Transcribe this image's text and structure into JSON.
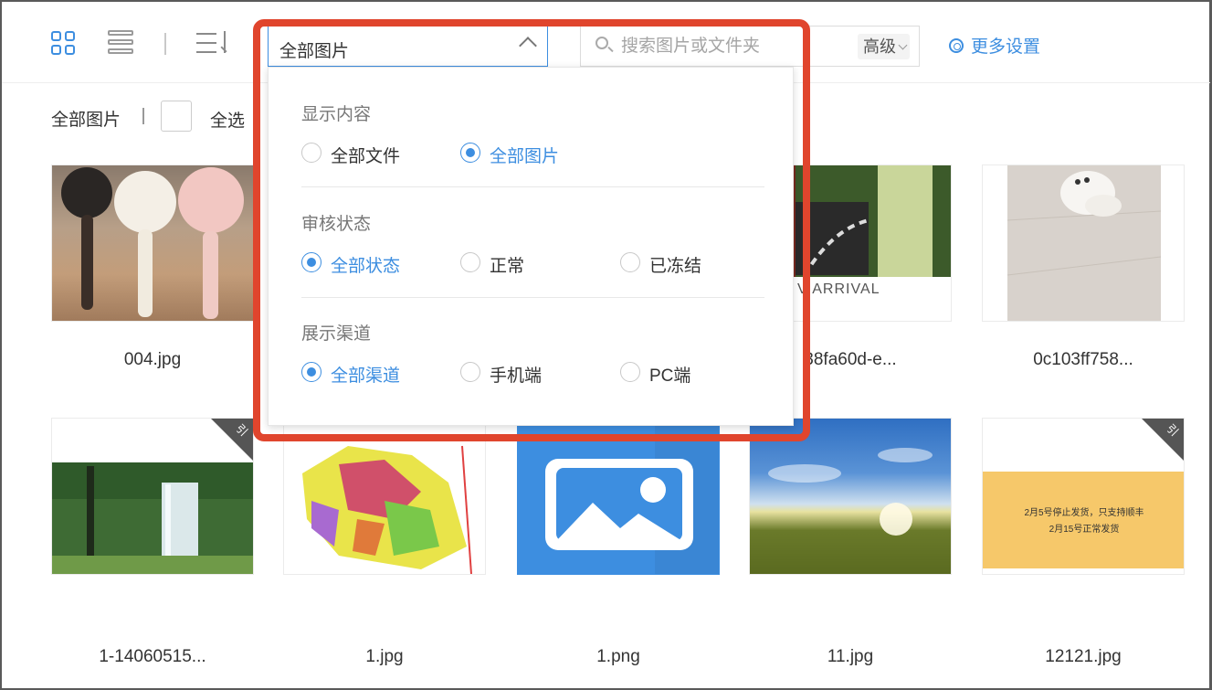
{
  "toolbar": {
    "view_select": {
      "value": "全部图片"
    },
    "search": {
      "placeholder": "搜索图片或文件夹",
      "advanced_label": "高级"
    },
    "more_settings_label": "更多设置"
  },
  "subbar": {
    "current_label": "全部图片",
    "separator": "|",
    "select_all_label": "全选"
  },
  "dropdown": {
    "sections": [
      {
        "title": "显示内容",
        "options": [
          {
            "label": "全部文件",
            "selected": false
          },
          {
            "label": "全部图片",
            "selected": true
          }
        ]
      },
      {
        "title": "审核状态",
        "options": [
          {
            "label": "全部状态",
            "selected": true
          },
          {
            "label": "正常",
            "selected": false
          },
          {
            "label": "已冻结",
            "selected": false
          }
        ]
      },
      {
        "title": "展示渠道",
        "options": [
          {
            "label": "全部渠道",
            "selected": true
          },
          {
            "label": "手机端",
            "selected": false
          },
          {
            "label": "PC端",
            "selected": false
          }
        ]
      }
    ]
  },
  "images": [
    {
      "name": "004.jpg"
    },
    {
      "name": "38fa60d-e...",
      "caption": "V ARRIVAL"
    },
    {
      "name": "0c103ff758..."
    },
    {
      "name": "1-14060515...",
      "corner": "引"
    },
    {
      "name": "1.jpg"
    },
    {
      "name": "1.png"
    },
    {
      "name": "11.jpg"
    },
    {
      "name": "12121.jpg",
      "corner": "引",
      "notice_line1": "2月5号停止发货，只支持顺丰",
      "notice_line2": "2月15号正常发货"
    }
  ],
  "colors": {
    "accent": "#3d8ee0",
    "highlight": "#e0452d",
    "border": "#5a5a5a"
  }
}
